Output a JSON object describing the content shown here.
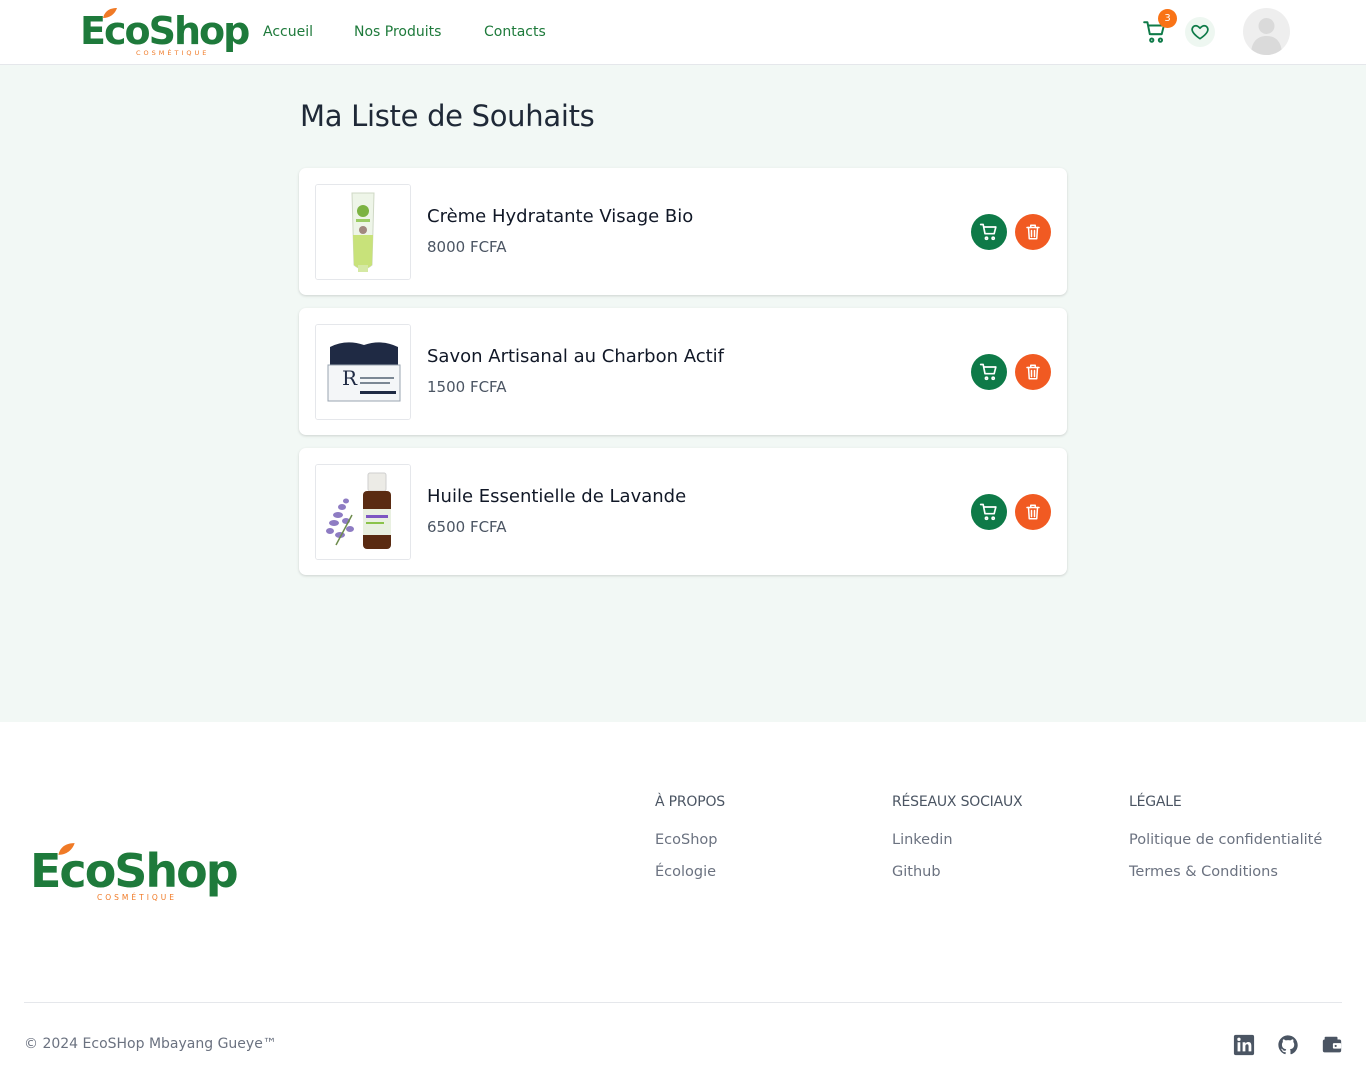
{
  "brand": {
    "name": "EcoShop",
    "tagline": "COSMÉTIQUE"
  },
  "nav": {
    "home": "Accueil",
    "products": "Nos Produits",
    "contacts": "Contacts"
  },
  "cart": {
    "count": "3"
  },
  "page": {
    "title": "Ma Liste de Souhaits"
  },
  "wishlist": [
    {
      "name": "Crème Hydratante Visage Bio",
      "price": "8000 FCFA"
    },
    {
      "name": "Savon Artisanal au Charbon Actif",
      "price": "1500 FCFA"
    },
    {
      "name": "Huile Essentielle de Lavande",
      "price": "6500 FCFA"
    }
  ],
  "footer": {
    "about": {
      "heading": "À PROPOS",
      "links": [
        "EcoShop",
        "Écologie"
      ]
    },
    "social": {
      "heading": "RÉSEAUX SOCIAUX",
      "links": [
        "Linkedin",
        "Github"
      ]
    },
    "legal": {
      "heading": "LÉGALE",
      "links": [
        "Politique de confidentialité",
        "Termes & Conditions"
      ]
    },
    "copyright": "© 2024 EcoSHop Mbayang Gueye™",
    "icons": [
      "linkedin-icon",
      "github-icon",
      "wallet-icon"
    ]
  },
  "colors": {
    "brand_green": "#1e7a3b",
    "action_green": "#0e7a48",
    "accent_orange": "#f15a22",
    "page_bg": "#f2f8f5"
  }
}
